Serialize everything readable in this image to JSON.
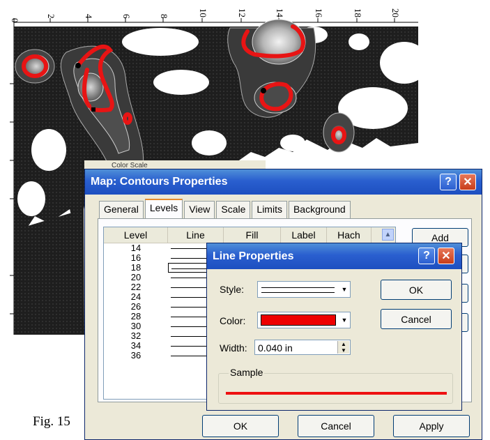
{
  "map": {
    "x_ticks": [
      "0",
      "2",
      "4",
      "6",
      "8",
      "10",
      "12",
      "14",
      "16",
      "18",
      "20"
    ],
    "obscured_window_title": "Color Scale"
  },
  "caption": "Fig. 15",
  "contours_window": {
    "title": "Map: Contours Properties",
    "help_glyph": "?",
    "close_glyph": "✕",
    "tabs": [
      "General",
      "Levels",
      "View",
      "Scale",
      "Limits",
      "Background"
    ],
    "active_tab": "Levels",
    "columns": [
      "Level",
      "Line",
      "Fill",
      "Label",
      "Hach"
    ],
    "levels": [
      "14",
      "16",
      "18",
      "20",
      "22",
      "24",
      "26",
      "28",
      "30",
      "32",
      "34",
      "36"
    ],
    "selected_level": "18",
    "side_buttons": [
      "Add"
    ],
    "bottom_buttons": [
      "OK",
      "Cancel",
      "Apply"
    ]
  },
  "line_dialog": {
    "title": "Line Properties",
    "help_glyph": "?",
    "close_glyph": "✕",
    "style_label": "Style:",
    "color_label": "Color:",
    "color_value": "#ee0000",
    "width_label": "Width:",
    "width_value": "0.040 in",
    "ok_label": "OK",
    "cancel_label": "Cancel",
    "sample_label": "Sample"
  },
  "colors": {
    "title_bar": "#2a5fcf",
    "dialog_bg": "#ece9d8",
    "contour_red": "#e81414"
  }
}
